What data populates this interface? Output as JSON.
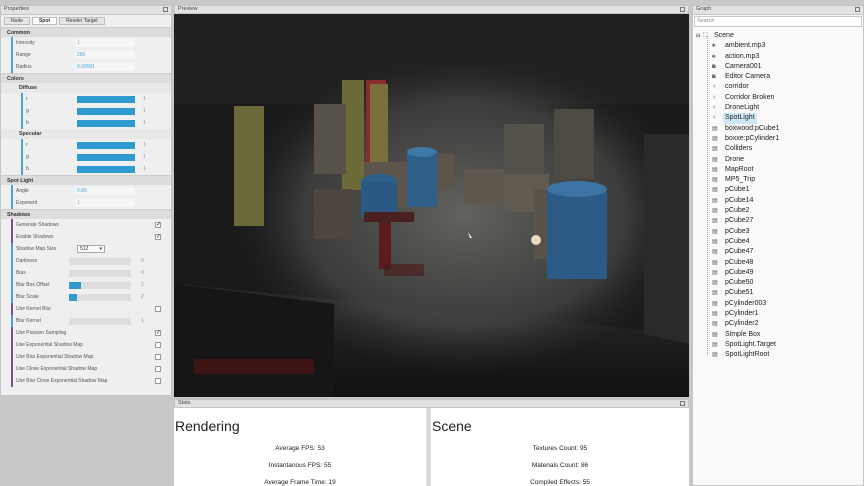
{
  "properties": {
    "title": "Properties",
    "tabs": [
      "Node",
      "Spot",
      "Render Target"
    ],
    "common": {
      "header": "Common",
      "intensity": {
        "label": "Intensity",
        "value": "1"
      },
      "range": {
        "label": "Range",
        "value": "250"
      },
      "radius": {
        "label": "Radius",
        "value": "0.00001"
      }
    },
    "colors": {
      "header": "Colors",
      "diffuse": {
        "header": "Diffuse",
        "r": {
          "label": "r",
          "value": "1",
          "fill": 1.0
        },
        "g": {
          "label": "g",
          "value": "1",
          "fill": 1.0
        },
        "b": {
          "label": "b",
          "value": "1",
          "fill": 1.0
        }
      },
      "specular": {
        "header": "Specular",
        "r": {
          "label": "r",
          "value": "1",
          "fill": 1.0
        },
        "g": {
          "label": "g",
          "value": "1",
          "fill": 1.0
        },
        "b": {
          "label": "b",
          "value": "1",
          "fill": 1.0
        }
      }
    },
    "spot": {
      "header": "Spot Light",
      "angle": {
        "label": "Angle",
        "value": "0.89"
      },
      "exponent": {
        "label": "Exponent",
        "value": "1"
      }
    },
    "shadows": {
      "header": "Shadows",
      "generate": {
        "label": "Generate Shadows",
        "checked": true
      },
      "enable": {
        "label": "Enable Shadows",
        "checked": true
      },
      "map_size": {
        "label": "Shadow Map Size",
        "value": "512"
      },
      "darkness": {
        "label": "Darkness",
        "value": "0",
        "fill": 0.0
      },
      "bias": {
        "label": "Bias",
        "value": "0",
        "fill": 0.0
      },
      "blur_offset": {
        "label": "Blur Box Offset",
        "value": "2",
        "fill": 0.2
      },
      "blur_scale": {
        "label": "Blur Scale",
        "value": "2",
        "fill": 0.13
      },
      "kernel_blur": {
        "label": "Use Kernel Blur",
        "checked": false
      },
      "blur_kernel": {
        "label": "Blur Kernel",
        "value": "1",
        "fill": 0.0
      },
      "poisson": {
        "label": "Use Poisson Sampling",
        "checked": true
      },
      "exp": {
        "label": "Use Exponential Shadow Map",
        "checked": false
      },
      "blur_exp": {
        "label": "Use Blur Exponential Shadow Map",
        "checked": false
      },
      "close_exp": {
        "label": "Use Close Exponential Shadow Map",
        "checked": false
      },
      "blur_close_exp": {
        "label": "Use Blur Close Exponential Shadow Map",
        "checked": false
      }
    }
  },
  "preview": {
    "title": "Preview"
  },
  "graph": {
    "title": "Graph",
    "search_placeholder": "Search",
    "root": "Scene",
    "items": [
      {
        "name": "ambient.mp3",
        "icon": "speaker-icon"
      },
      {
        "name": "action.mp3",
        "icon": "speaker-icon"
      },
      {
        "name": "Camera001",
        "icon": "camera-icon"
      },
      {
        "name": "Editor Camera",
        "icon": "camera-icon"
      },
      {
        "name": "corridor",
        "icon": "light-icon"
      },
      {
        "name": "Corridor Broken",
        "icon": "light-icon"
      },
      {
        "name": "DroneLight",
        "icon": "light-icon"
      },
      {
        "name": "SpotLight",
        "icon": "light-icon",
        "selected": true
      },
      {
        "name": "boxwood:pCube1",
        "icon": "mesh-icon"
      },
      {
        "name": "boxxe:pCylinder1",
        "icon": "mesh-icon"
      },
      {
        "name": "Colliders",
        "icon": "mesh-icon"
      },
      {
        "name": "Drone",
        "icon": "mesh-icon"
      },
      {
        "name": "MapRoot",
        "icon": "mesh-icon"
      },
      {
        "name": "MP5_Trip",
        "icon": "mesh-icon"
      },
      {
        "name": "pCube1",
        "icon": "mesh-icon"
      },
      {
        "name": "pCube14",
        "icon": "mesh-icon"
      },
      {
        "name": "pCube2",
        "icon": "mesh-icon"
      },
      {
        "name": "pCube27",
        "icon": "mesh-icon"
      },
      {
        "name": "pCube3",
        "icon": "mesh-icon"
      },
      {
        "name": "pCube4",
        "icon": "mesh-icon"
      },
      {
        "name": "pCube47",
        "icon": "mesh-icon"
      },
      {
        "name": "pCube48",
        "icon": "mesh-icon"
      },
      {
        "name": "pCube49",
        "icon": "mesh-icon"
      },
      {
        "name": "pCube50",
        "icon": "mesh-icon"
      },
      {
        "name": "pCube51",
        "icon": "mesh-icon"
      },
      {
        "name": "pCylinder003",
        "icon": "mesh-icon"
      },
      {
        "name": "pCylinder1",
        "icon": "mesh-icon"
      },
      {
        "name": "pCylinder2",
        "icon": "mesh-icon"
      },
      {
        "name": "Simple Box",
        "icon": "mesh-icon"
      },
      {
        "name": "SpotLight.Target",
        "icon": "mesh-icon"
      },
      {
        "name": "SpotLightRoot",
        "icon": "mesh-icon"
      }
    ]
  },
  "stats": {
    "title": "Stats",
    "rendering": {
      "heading": "Rendering",
      "lines": [
        "Average FPS: 53",
        "Instantanous FPS: 55",
        "Average Frame Time: 19"
      ]
    },
    "scene": {
      "heading": "Scene",
      "lines": [
        "Textures Count: 95",
        "Materials Count: 86",
        "Compiled Effects: 55"
      ]
    }
  },
  "colors": {
    "accent": "#2f9ad0",
    "selection": "#cfe8f8"
  }
}
